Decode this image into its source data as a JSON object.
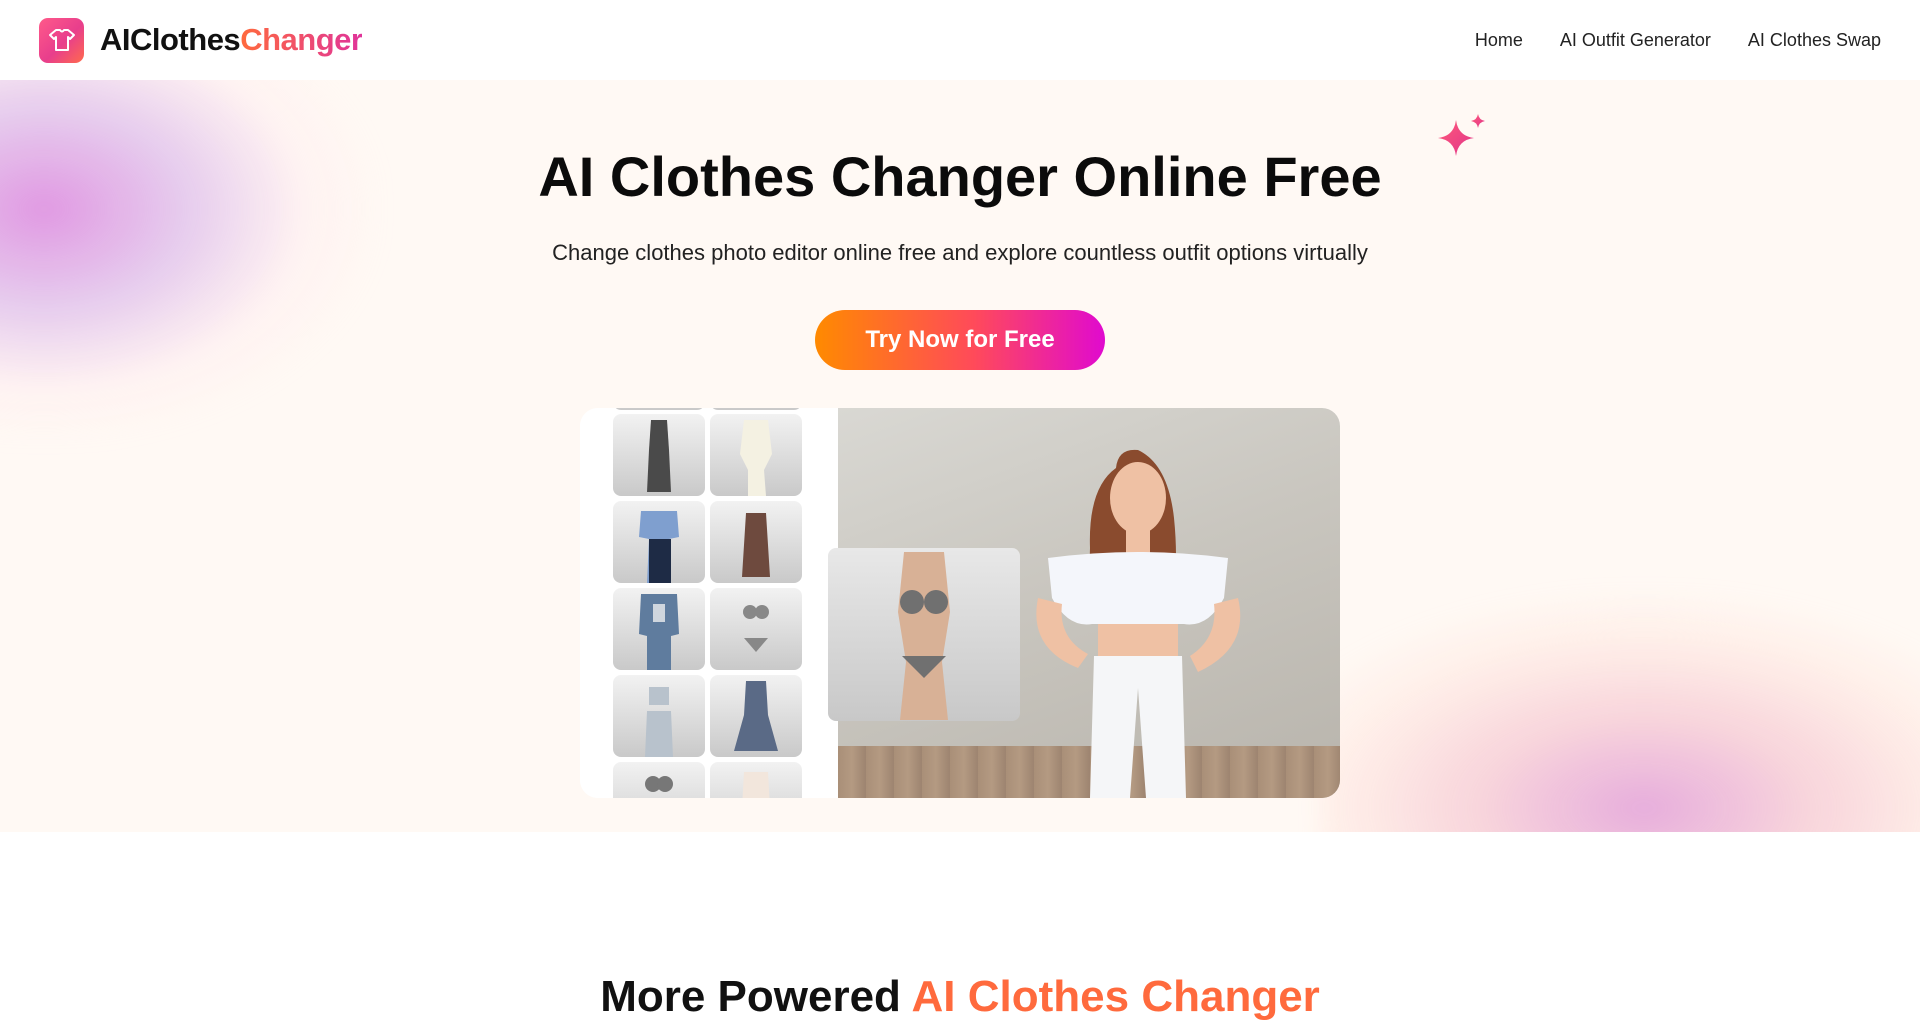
{
  "header": {
    "brand_part1": "AIClothes",
    "brand_part2": "Changer",
    "logo_icon": "shirt-icon",
    "nav": [
      {
        "label": "Home"
      },
      {
        "label": "AI Outfit Generator"
      },
      {
        "label": "AI Clothes Swap"
      }
    ]
  },
  "hero": {
    "title": "AI Clothes Changer Online Free",
    "subtitle": "Change clothes photo editor online free and explore countless outfit options virtually",
    "cta_label": "Try Now for Free",
    "sparkle_icon": "sparkle-icon"
  },
  "next_section": {
    "title_start": "More Powered ",
    "title_highlight": "AI Clothes Changer"
  },
  "colors": {
    "accent_orange": "#ff8a00",
    "accent_pink": "#e00acf",
    "hero_bg": "#fff9f4"
  }
}
